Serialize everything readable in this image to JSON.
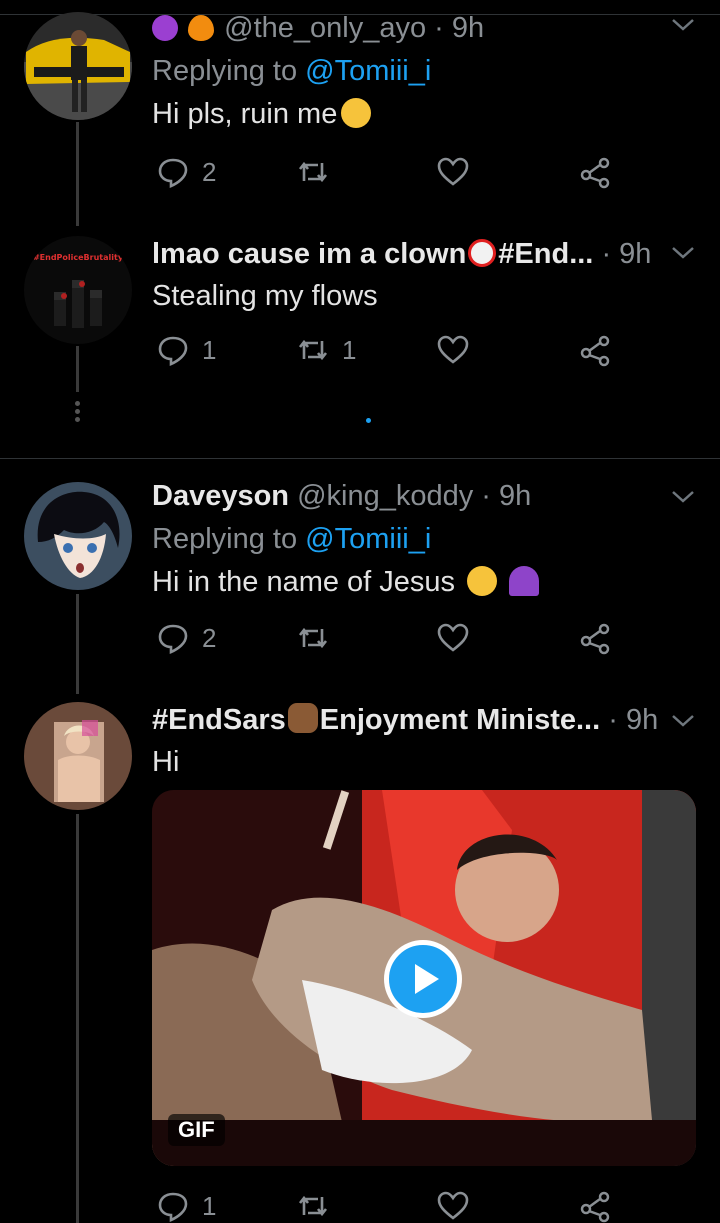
{
  "tweets": [
    {
      "author_emojis": [
        "devil-emoji",
        "fire-emoji"
      ],
      "handle": "@the_only_ayo",
      "time": "· 9h",
      "replying_prefix": "Replying to ",
      "replying_to": "@Tomiii_i",
      "text": "Hi pls, ruin me",
      "text_emoji": "woozy-face-emoji",
      "replies": "2",
      "retweets": "",
      "likes": ""
    },
    {
      "name": "lmao cause im a clown",
      "name_emoji": "clown-emoji",
      "name_suffix": "#End...",
      "time": "· 9h",
      "text": "Stealing my flows",
      "avatar_label": "#EndPoliceBrutality",
      "replies": "1",
      "retweets": "1",
      "likes": ""
    },
    {
      "name": "Daveyson",
      "handle": "@king_koddy",
      "time": "· 9h",
      "replying_prefix": "Replying to ",
      "replying_to": "@Tomiii_i",
      "text": "Hi in the name of Jesus",
      "text_emojis": [
        "weary-face-emoji",
        "purple-heart-emoji"
      ],
      "replies": "2",
      "retweets": "",
      "likes": ""
    },
    {
      "name_prefix": "#EndSars",
      "name_emoji": "raised-fist-emoji",
      "name": "Enjoyment Ministe...",
      "time": "· 9h",
      "text": "Hi",
      "media_badge": "GIF",
      "replies": "1",
      "retweets": "",
      "likes": ""
    }
  ],
  "colors": {
    "background": "#000000",
    "accent": "#1da1f2",
    "muted": "#8a8f94",
    "text": "#e3e3e3"
  }
}
